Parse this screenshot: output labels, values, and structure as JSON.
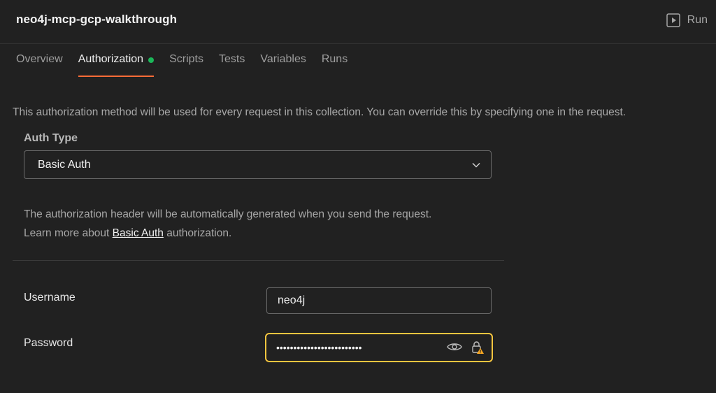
{
  "header": {
    "title": "neo4j-mcp-gcp-walkthrough",
    "run_label": "Run"
  },
  "tabs": [
    {
      "label": "Overview",
      "active": false
    },
    {
      "label": "Authorization",
      "active": true,
      "indicator_color": "#1bb659"
    },
    {
      "label": "Scripts",
      "active": false
    },
    {
      "label": "Tests",
      "active": false
    },
    {
      "label": "Variables",
      "active": false
    },
    {
      "label": "Runs",
      "active": false
    }
  ],
  "main": {
    "description": "This authorization method will be used for every request in this collection. You can override this by specifying one in the request.",
    "auth_type_label": "Auth Type",
    "auth_type_value": "Basic Auth",
    "info_line1": "The authorization header will be automatically generated when you send the request.",
    "info_line2_prefix": "Learn more about ",
    "info_link": "Basic Auth",
    "info_line2_suffix": " authorization.",
    "username_label": "Username",
    "username_value": "neo4j",
    "password_label": "Password",
    "password_masked": "•••••••••••••••••••••••••"
  },
  "colors": {
    "background": "#212121",
    "active_tab_underline": "#ff6c37",
    "focus_border": "#f5c53f",
    "warning": "#f5a623"
  },
  "icons": {
    "run": "play-square-icon",
    "dropdown": "chevron-down-icon",
    "reveal": "eye-icon",
    "vault": "lock-warning-icon"
  }
}
